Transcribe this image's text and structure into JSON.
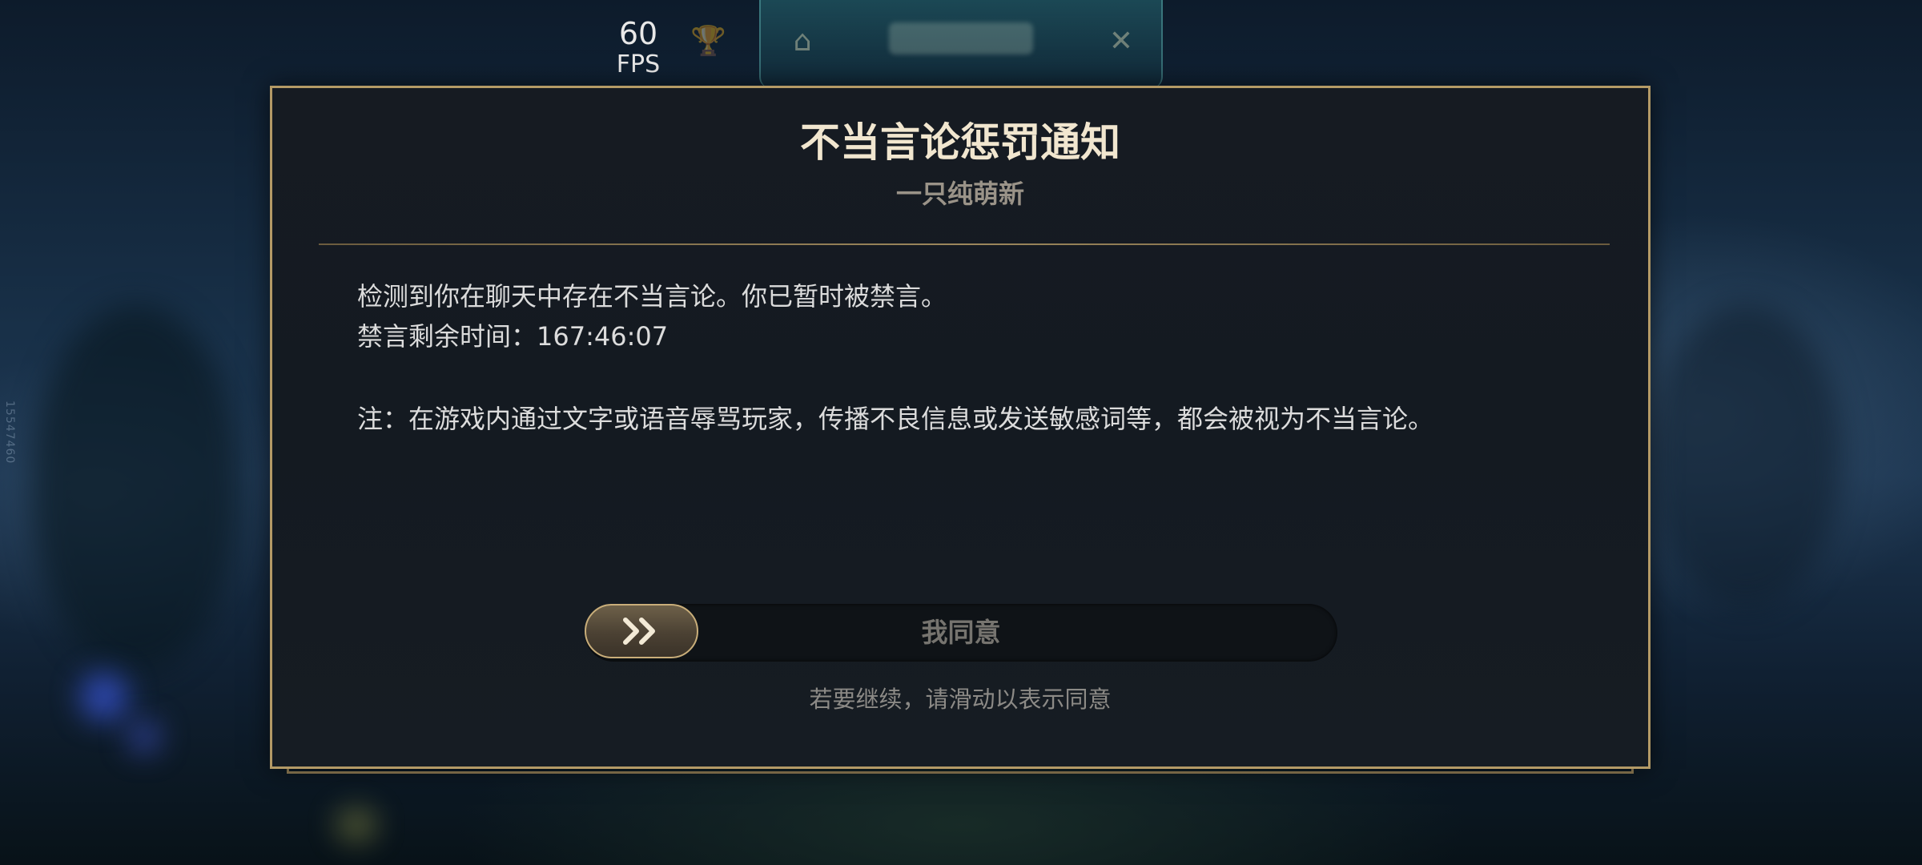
{
  "overlay": {
    "vertical_id": "15547460",
    "fps_value": "60",
    "fps_label": "FPS"
  },
  "dialog": {
    "title": "不当言论惩罚通知",
    "subtitle": "一只纯萌新",
    "message_line1": "检测到你在聊天中存在不当言论。你已暂时被禁言。",
    "message_line2": "禁言剩余时间：167:46:07",
    "note": "注：在游戏内通过文字或语音辱骂玩家，传播不良信息或发送敏感词等，都会被视为不当言论。",
    "slider_label": "我同意",
    "slider_icon": "double-chevron-right-icon",
    "hint": "若要继续，请滑动以表示同意"
  },
  "colors": {
    "accent_gold": "#b49a66",
    "title_text": "#f1e6cf",
    "dialog_bg": "#161b22"
  }
}
